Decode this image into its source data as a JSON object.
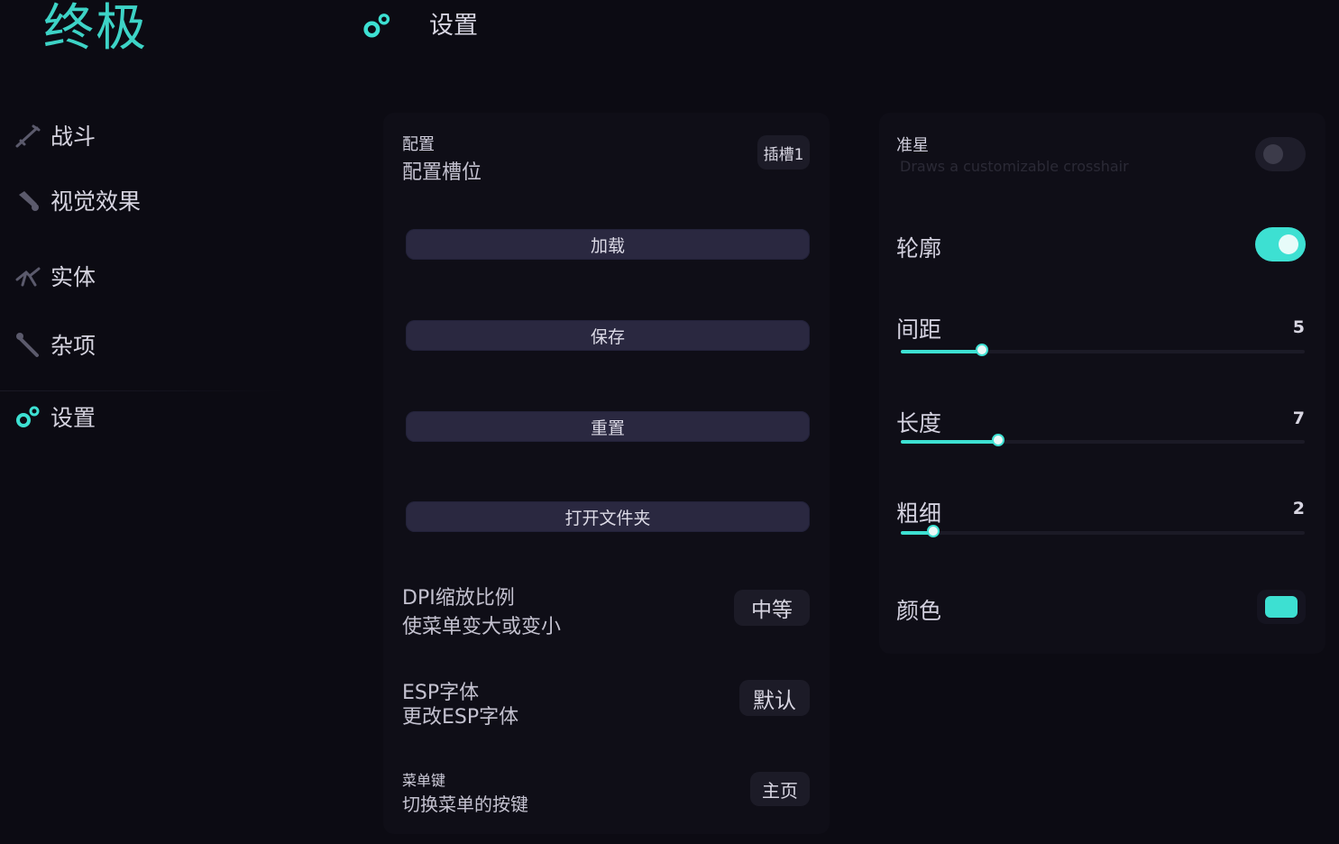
{
  "app": {
    "logo": "终极"
  },
  "header": {
    "title": "设置",
    "icon": "gears-icon"
  },
  "sidebar": {
    "items": [
      {
        "label": "战斗",
        "icon": "sword-icon"
      },
      {
        "label": "视觉效果",
        "icon": "eye-icon"
      },
      {
        "label": "实体",
        "icon": "creature-icon"
      },
      {
        "label": "杂项",
        "icon": "wrench-icon"
      },
      {
        "label": "设置",
        "icon": "gears-icon"
      }
    ]
  },
  "config": {
    "title": "配置",
    "subtitle": "配置槽位",
    "slot_value": "插槽1",
    "buttons": {
      "load": "加载",
      "save": "保存",
      "reset": "重置",
      "open_folder": "打开文件夹"
    }
  },
  "dpi": {
    "title": "DPI缩放比例",
    "subtitle": "使菜单变大或变小",
    "value": "中等"
  },
  "esp_font": {
    "title": "ESP字体",
    "subtitle": "更改ESP字体",
    "value": "默认"
  },
  "menu_key": {
    "title": "菜单键",
    "subtitle": "切换菜单的按键",
    "value": "主页"
  },
  "crosshair": {
    "title": "准星",
    "description": "Draws a customizable crosshair",
    "enabled": false,
    "outline": {
      "label": "轮廓",
      "enabled": true
    },
    "gap": {
      "label": "间距",
      "value": "5",
      "fraction": 0.2
    },
    "length": {
      "label": "长度",
      "value": "7",
      "fraction": 0.24
    },
    "thickness": {
      "label": "粗细",
      "value": "2",
      "fraction": 0.08
    },
    "color": {
      "label": "颜色",
      "value": "#3de0d2"
    }
  },
  "colors": {
    "accent": "#3de0d2",
    "background": "#0c0b13",
    "button": "#2a2840"
  }
}
